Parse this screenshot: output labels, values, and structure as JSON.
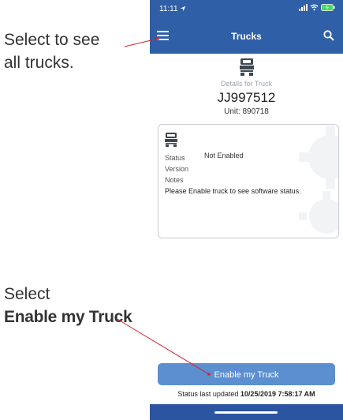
{
  "callouts": {
    "menu_hint_line1": "Select to see",
    "menu_hint_line2": "all trucks.",
    "enable_hint_line1": "Select",
    "enable_hint_line2": "Enable my Truck"
  },
  "status_bar": {
    "time": "11:11",
    "icons": [
      "location-arrow-icon",
      "signal-icon",
      "wifi-icon",
      "battery-charging-icon"
    ]
  },
  "nav": {
    "title": "Trucks",
    "left_icon": "menu-icon",
    "right_icon": "search-icon"
  },
  "truck": {
    "caption": "Details for Truck",
    "id": "JJ997512",
    "unit_label": "Unit: 890718",
    "icon": "truck-icon"
  },
  "card": {
    "status_label": "Status",
    "status_value": "Not Enabled",
    "version_label": "Version",
    "version_value": "",
    "notes_label": "Notes",
    "notes_value": "",
    "message": "Please Enable truck to see software status.",
    "background_icon": "gear-icon"
  },
  "actions": {
    "enable_label": "Enable my Truck"
  },
  "footer": {
    "updated_prefix": "Status last updated",
    "updated_value": "10/25/2019 7:58:17 AM"
  },
  "colors": {
    "brand_blue": "#2f5fa6",
    "button_blue": "#5b8fd0",
    "callout_line": "#d1242f"
  }
}
